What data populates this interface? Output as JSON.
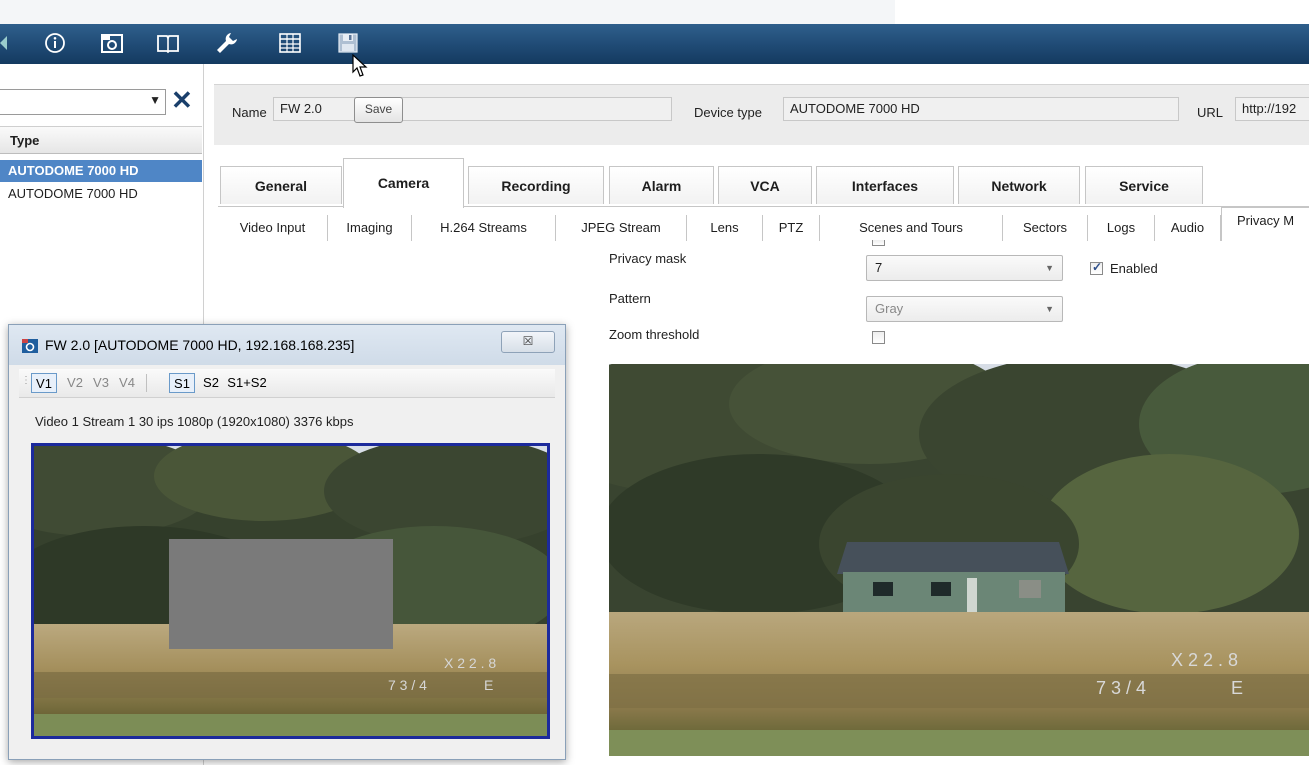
{
  "toolbar": {
    "icons": [
      "info-icon",
      "camera-icon",
      "book-icon",
      "wrench-icon",
      "table-icon",
      "save-disk-icon"
    ]
  },
  "left_panel": {
    "search_value": "",
    "column_header": "Type",
    "rows": [
      "AUTODOME 7000 HD",
      "AUTODOME 7000 HD"
    ]
  },
  "info_bar": {
    "name_label": "Name",
    "name_value": "FW 2.0",
    "save_label": "Save",
    "device_type_label": "Device type",
    "device_type_value": "AUTODOME 7000 HD",
    "url_label": "URL",
    "url_value": "http://192"
  },
  "tabs": [
    "General",
    "Camera",
    "Recording",
    "Alarm",
    "VCA",
    "Interfaces",
    "Network",
    "Service"
  ],
  "active_tab": "Camera",
  "subtabs": [
    "Video Input",
    "Imaging",
    "H.264 Streams",
    "JPEG Stream",
    "Lens",
    "PTZ",
    "Scenes and Tours",
    "Sectors",
    "Logs",
    "Audio",
    "Privacy M"
  ],
  "active_subtab": "Privacy M",
  "privacy": {
    "mask_label": "Privacy mask",
    "mask_value": "7",
    "enabled_label": "Enabled",
    "enabled": true,
    "pattern_label": "Pattern",
    "pattern_value": "Gray",
    "zoom_label": "Zoom threshold",
    "zoom_checked": false
  },
  "big_video": {
    "osd_zoom": "X 2 2 . 8",
    "osd_pos": "7 3 / 4",
    "osd_dir": "E"
  },
  "popup": {
    "title": "FW 2.0 [AUTODOME 7000 HD, 192.168.168.235]",
    "close_glyph": "☒",
    "view_buttons": [
      "V1",
      "V2",
      "V3",
      "V4",
      "S1",
      "S2",
      "S1+S2"
    ],
    "status": "Video 1   Stream 1   30 ips   1080p (1920x1080)   3376 kbps",
    "osd_zoom": "X 2 2 . 8",
    "osd_pos": "7 3 / 4",
    "osd_dir": "E"
  },
  "colors": {
    "toolbar": "#1f4a74",
    "selection": "#4f86c6",
    "mask_gray": "#7a7a7a",
    "popup_border": "#1c2a9c"
  }
}
